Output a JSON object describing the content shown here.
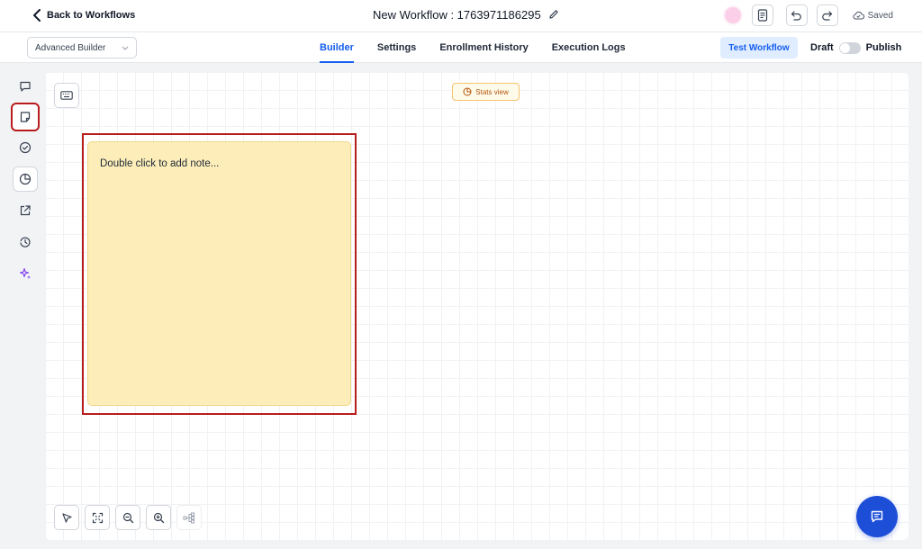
{
  "header": {
    "back_label": "Back to Workflows",
    "workflow_title": "New Workflow : 1763971186295",
    "saved_label": "Saved"
  },
  "subbar": {
    "mode_select": "Advanced Builder",
    "tabs": [
      {
        "label": "Builder",
        "active": true
      },
      {
        "label": "Settings",
        "active": false
      },
      {
        "label": "Enrollment History",
        "active": false
      },
      {
        "label": "Execution Logs",
        "active": false
      }
    ],
    "test_button": "Test Workflow",
    "draft_label": "Draft",
    "publish_label": "Publish",
    "published": false
  },
  "sidebar": {
    "items": [
      {
        "icon": "comment-icon"
      },
      {
        "icon": "note-icon",
        "selected": true
      },
      {
        "icon": "check-circle-icon"
      },
      {
        "icon": "pie-chart-icon"
      },
      {
        "icon": "external-link-icon"
      },
      {
        "icon": "history-icon"
      },
      {
        "icon": "sparkle-icon"
      }
    ]
  },
  "canvas": {
    "stats_view_label": "Stats view",
    "note_placeholder": "Double click to add note..."
  },
  "colors": {
    "accent": "#155eef",
    "note_bg": "#fdeeb9",
    "highlight": "#b91c1c",
    "fab": "#1d4ed8"
  }
}
